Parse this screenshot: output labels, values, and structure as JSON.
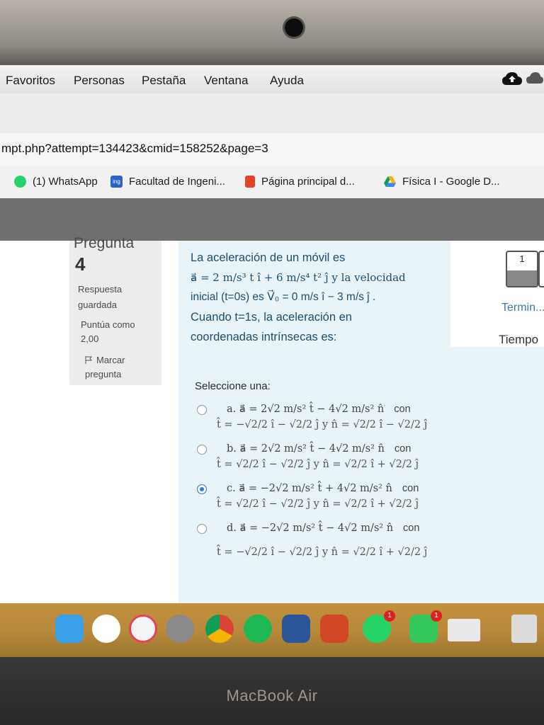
{
  "menu": {
    "items": [
      "Favoritos",
      "Personas",
      "Pestaña",
      "Ventana",
      "Ayuda"
    ]
  },
  "url": "mpt.php?attempt=134423&cmid=158252&page=3",
  "bookmarks": [
    {
      "label": "(1) WhatsApp",
      "icon": "whatsapp-icon",
      "color": "#25d366"
    },
    {
      "label": "Facultad de Ingeni...",
      "icon": "ing-icon",
      "color": "#2a62c9"
    },
    {
      "label": "Página principal d...",
      "icon": "office-icon",
      "color": "#e0452b"
    },
    {
      "label": "Física I - Google D...",
      "icon": "google-drive-icon",
      "color": "#f4b400"
    }
  ],
  "question": {
    "label": "Pregunta",
    "number": "4",
    "status": [
      "Respuesta",
      "guardada"
    ],
    "score": [
      "Puntúa como",
      "2,00"
    ],
    "flag": [
      "Marcar",
      "pregunta"
    ],
    "text_lines": [
      "La aceleración de un móvil es",
      "a⃗ = 2 m/s³ t î + 6 m/s⁴ t² ĵ   y la velocidad",
      "inicial (t=0s) es V⃗₀ = 0 m/s î − 3 m/s ĵ  .",
      "Cuando t=1s, la aceleración en",
      "coordenadas intrínsecas es:"
    ],
    "select_label": "Seleccione una:",
    "options": [
      {
        "line1": "a. a⃗ = 2√2 m/s² t̂ − 4√2 m/s² n̂",
        "line2": "t̂ = −√2/2 î − √2/2 ĵ  y  n̂ = √2/2 î − √2/2 ĵ",
        "selected": false
      },
      {
        "line1": "b. a⃗ = 2√2 m/s² t̂ − 4√2 m/s² n̂",
        "line2": "t̂ = √2/2 î − √2/2 ĵ  y  n̂ = √2/2 î + √2/2 ĵ",
        "selected": false
      },
      {
        "line1": "c. a⃗ = −2√2 m/s² t̂ + 4√2 m/s² n̂",
        "line2": "t̂ = √2/2 î − √2/2 ĵ  y  n̂ = √2/2 î + √2/2 ĵ",
        "selected": true
      },
      {
        "line1": "d. a⃗ = −2√2 m/s² t̂ − 4√2 m/s² n̂",
        "line2": "t̂ = −√2/2 î − √2/2 ĵ  y  n̂ = √2/2 î + √2/2 ĵ",
        "selected": false
      }
    ],
    "con_word": "con"
  },
  "nav": {
    "page_number": "1",
    "finish_link": "Termin...",
    "time_label": "Tiempo"
  },
  "dock_badges": [
    "1",
    "1"
  ],
  "laptop_label": "MacBook Air"
}
